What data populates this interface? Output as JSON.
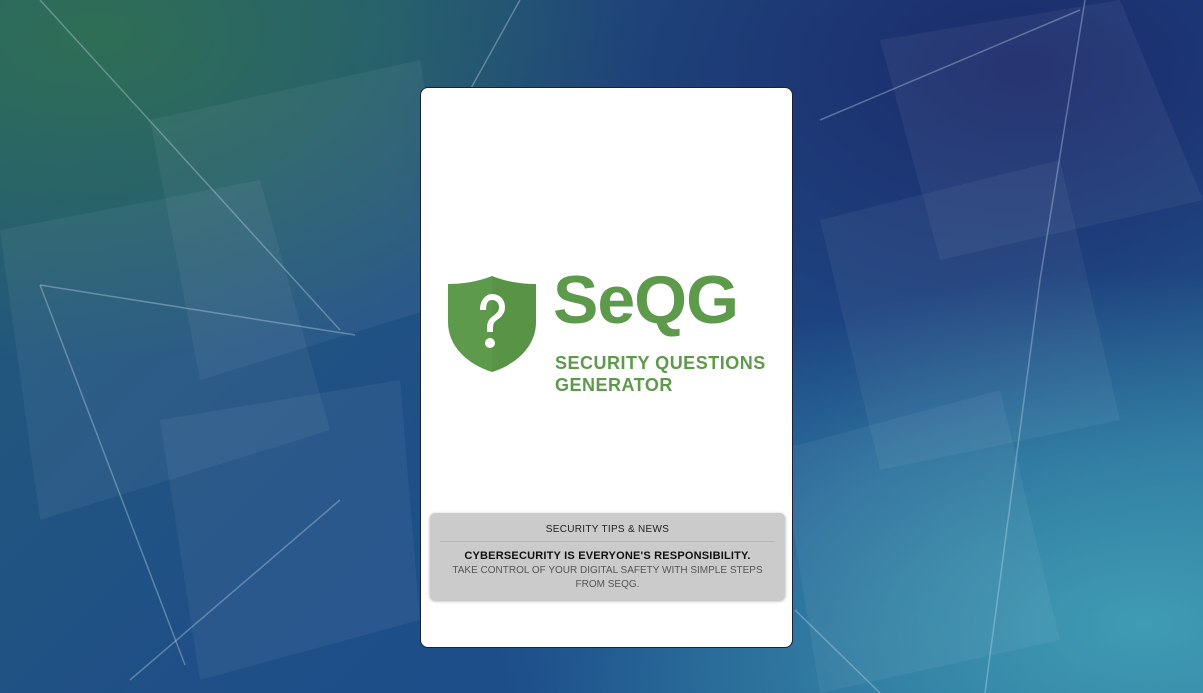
{
  "brand": {
    "name": "SeQG",
    "tagline": "SECURITY QUESTIONS GENERATOR",
    "color": "#5e9a4b",
    "icon": "shield-question-icon"
  },
  "tips": {
    "title": "SECURITY TIPS & NEWS",
    "headline": "CYBERSECURITY IS EVERYONE'S RESPONSIBILITY.",
    "body": "TAKE CONTROL OF YOUR DIGITAL SAFETY WITH SIMPLE STEPS FROM SEQG."
  },
  "colors": {
    "card_background": "#ffffff",
    "tips_background": "#cbcbcb"
  }
}
